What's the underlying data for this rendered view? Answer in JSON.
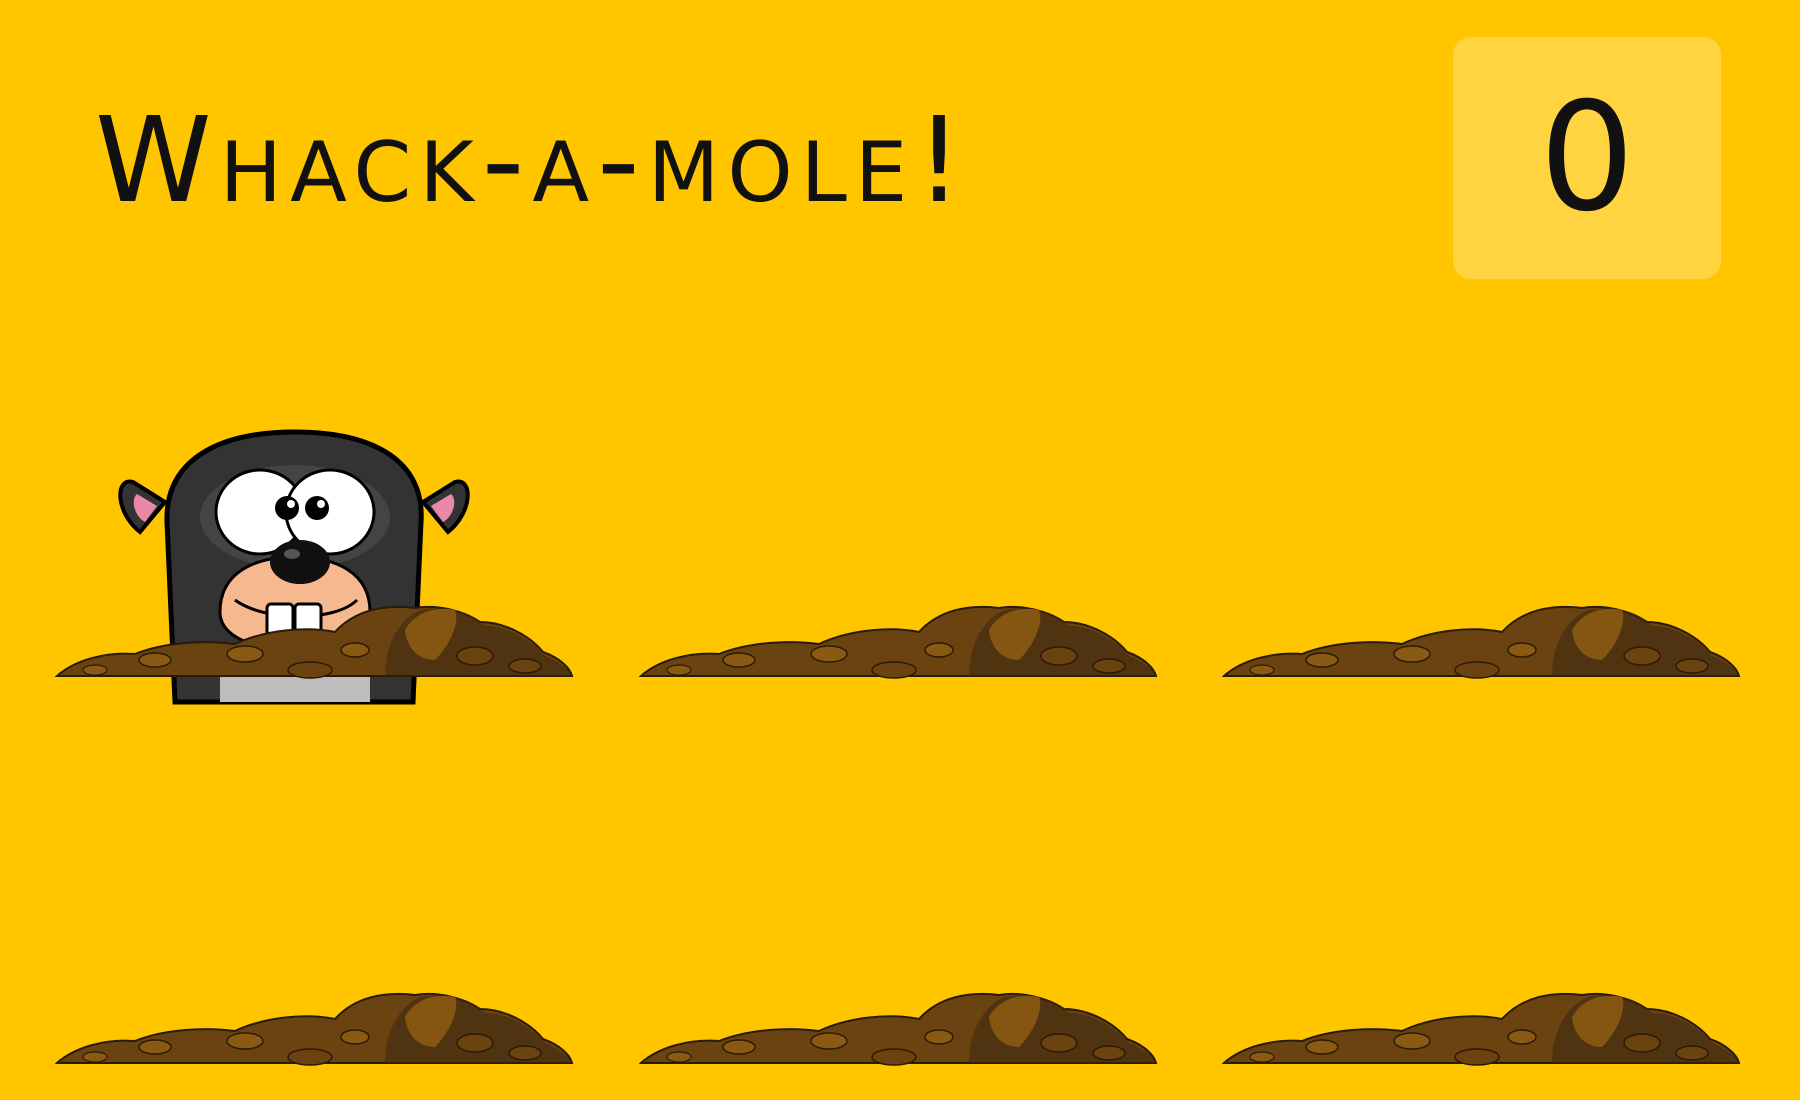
{
  "game": {
    "title": "Whack-a-mole!",
    "score": "0",
    "colors": {
      "background": "#FFC600",
      "dirt_dark": "#3A2610",
      "dirt_mid": "#6B4310",
      "dirt_light": "#8A5A12",
      "mole_body": "#333333"
    },
    "holes": [
      {
        "id": 1,
        "mole_visible": true
      },
      {
        "id": 2,
        "mole_visible": false
      },
      {
        "id": 3,
        "mole_visible": false
      },
      {
        "id": 4,
        "mole_visible": false
      },
      {
        "id": 5,
        "mole_visible": false
      },
      {
        "id": 6,
        "mole_visible": false
      }
    ]
  }
}
